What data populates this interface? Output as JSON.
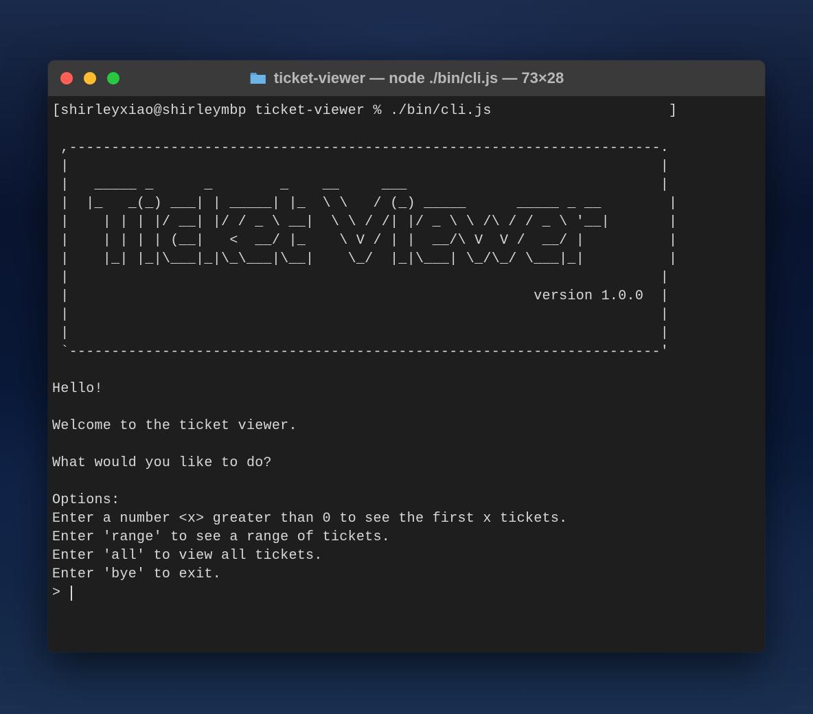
{
  "window": {
    "title": "ticket-viewer — node ./bin/cli.js — 73×28"
  },
  "terminal": {
    "prompt": "[shirleyxiao@shirleymbp ticket-viewer % ./bin/cli.js                     ]",
    "banner": " ,----------------------------------------------------------------------.\n |                                                                      |\n |   _____ _      _        _    __     ___                              |\n |  |_   _(_) ___| | _____| |_  \\ \\   / (_) _____      _____ _ __        |\n |    | | | |/ __| |/ / _ \\ __|  \\ \\ / /| |/ _ \\ \\ /\\ / / _ \\ '__|       |\n |    | | | | (__|   <  __/ |_    \\ V / | |  __/\\ V  V /  __/ |          |\n |    |_| |_|\\___|_|\\_\\___|\\__|    \\_/  |_|\\___| \\_/\\_/ \\___|_|          |\n |                                                                      |\n |                                                       version 1.0.0  |\n |                                                                      |\n |                                                                      |\n `----------------------------------------------------------------------'",
    "greeting": "Hello!",
    "welcome": "Welcome to the ticket viewer.",
    "question": "What would you like to do?",
    "options_header": "Options:",
    "options": [
      "Enter a number <x> greater than 0 to see the first x tickets.",
      "Enter 'range' to see a range of tickets.",
      "Enter 'all' to view all tickets.",
      "Enter 'bye' to exit."
    ],
    "input_prompt": "> "
  }
}
